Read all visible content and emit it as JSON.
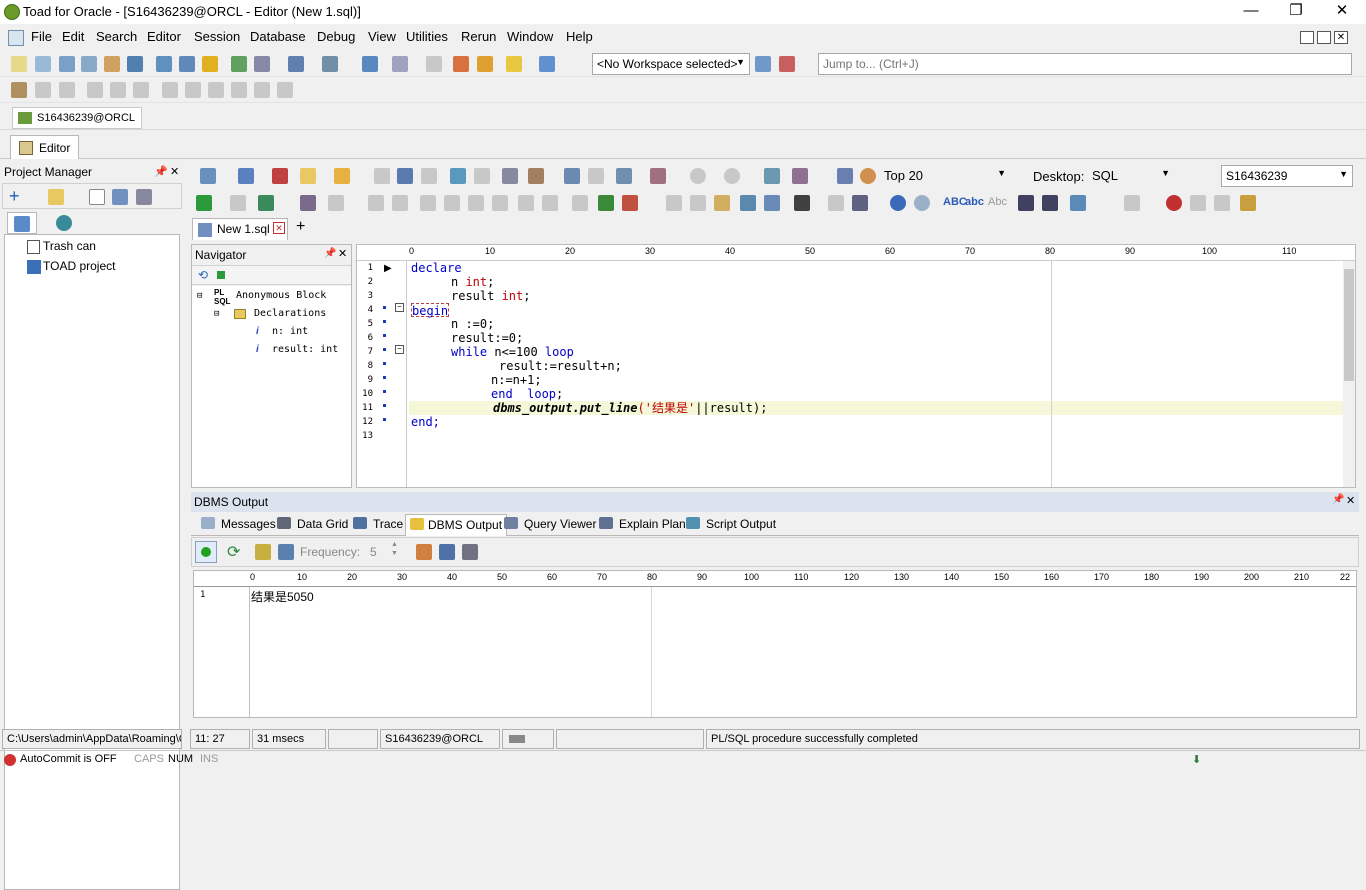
{
  "window": {
    "title": "Toad for Oracle - [S16436239@ORCL - Editor (New 1.sql)]",
    "min": "—",
    "restore": "❐",
    "close": "✕"
  },
  "menu": [
    "File",
    "Edit",
    "Search",
    "Editor",
    "Session",
    "Database",
    "Debug",
    "View",
    "Utilities",
    "Rerun",
    "Window",
    "Help"
  ],
  "toolbar": {
    "workspace": "<No Workspace selected>",
    "jump_placeholder": "Jump to... (Ctrl+J)"
  },
  "connection_tab": "S16436239@ORCL",
  "window_tab": "Editor",
  "project_manager": {
    "title": "Project Manager",
    "items": [
      "Trash can",
      "TOAD project"
    ]
  },
  "editor_toolbar": {
    "top_label": "Top 20",
    "desktop_label": "Desktop:",
    "desktop_value": "SQL",
    "schema": "S16436239"
  },
  "doc_tab": "New 1.sql",
  "navigator": {
    "title": "Navigator",
    "root": "Anonymous Block",
    "declarations": "Declarations",
    "vars": [
      "n: int",
      "result: int"
    ]
  },
  "ruler": [
    "0",
    "10",
    "20",
    "30",
    "40",
    "50",
    "60",
    "70",
    "80",
    "90",
    "100",
    "110"
  ],
  "code_lines": [
    "1",
    "2",
    "3",
    "4",
    "5",
    "6",
    "7",
    "8",
    "9",
    "10",
    "11",
    "12",
    "13"
  ],
  "code": {
    "l1": "declare",
    "l2a": "n ",
    "l2b": "int",
    ";": ";",
    "l3a": "result ",
    "l3b": "int",
    "l4": "begin",
    "l5": "n :=0;",
    "l6": "result:=0;",
    "l7a": "while",
    "l7b": " n<=100 ",
    "l7c": "loop",
    "l8": "result:=result+n;",
    "l9": "n:=n+1;",
    "l10a": "end",
    "l10b": "  loop",
    "l11a": "dbms_output.put_line",
    "l11b": "('结果是'",
    "l11c": "||result);",
    "l12": "end;"
  },
  "output": {
    "title": "DBMS Output",
    "tabs": [
      "Messages",
      "Data Grid",
      "Trace",
      "DBMS Output",
      "Query Viewer",
      "Explain Plan",
      "Script Output"
    ],
    "frequency_label": "Frequency:",
    "frequency_value": "5",
    "ruler": [
      "0",
      "10",
      "20",
      "30",
      "40",
      "50",
      "60",
      "70",
      "80",
      "90",
      "100",
      "110",
      "120",
      "130",
      "140",
      "150",
      "160",
      "170",
      "180",
      "190",
      "200",
      "210",
      "22"
    ],
    "line_no": "1",
    "result_text": "结果是5050"
  },
  "statusbar": {
    "path": "C:\\Users\\admin\\AppData\\Roaming\\Q",
    "pos": "11: 27",
    "time": "31 msecs",
    "conn": "S16436239@ORCL",
    "msg": "PL/SQL procedure successfully completed",
    "autocommit": "AutoCommit is OFF",
    "caps": "CAPS",
    "num": "NUM",
    "ins": "INS"
  }
}
